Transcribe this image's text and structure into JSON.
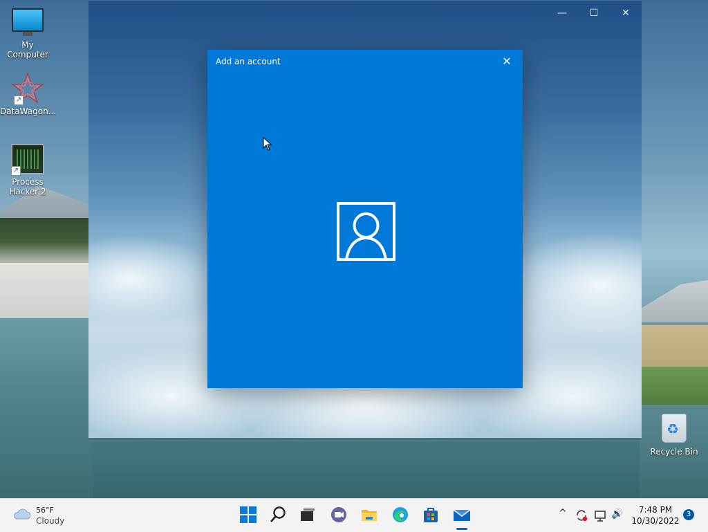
{
  "desktop": {
    "icons": [
      {
        "label": "My Computer"
      },
      {
        "label": "DataWagon..."
      },
      {
        "label": "Process Hacker 2"
      },
      {
        "label": "Recycle Bin"
      }
    ]
  },
  "app_window": {
    "controls": {
      "minimize": "—",
      "maximize": "☐",
      "close": "✕"
    }
  },
  "dialog": {
    "title": "Add an account",
    "close": "✕",
    "icon": "person-icon",
    "background": "#0078d7"
  },
  "taskbar": {
    "weather": {
      "temp": "56°F",
      "condition": "Cloudy"
    },
    "apps": [
      "start-icon",
      "search-icon",
      "task-view-icon",
      "teams-chat-icon",
      "file-explorer-icon",
      "edge-icon",
      "store-icon",
      "mail-icon"
    ],
    "tray": {
      "chevron": "^",
      "volume": "🔊"
    },
    "clock": {
      "time": "7:48 PM",
      "date": "10/30/2022"
    },
    "notifications": "3"
  }
}
